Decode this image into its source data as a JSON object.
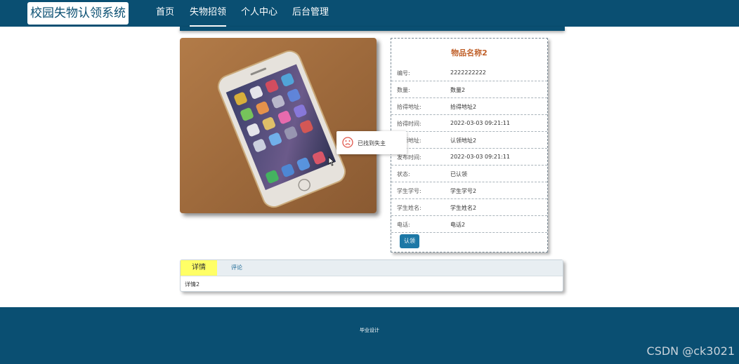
{
  "app": {
    "title": "校园失物认领系统"
  },
  "nav": [
    "首页",
    "失物招领",
    "个人中心",
    "后台管理"
  ],
  "item": {
    "name": "物品名称2",
    "fields": [
      {
        "label": "编号:",
        "value": "2222222222"
      },
      {
        "label": "数量:",
        "value": "数量2"
      },
      {
        "label": "拾得地址:",
        "value": "拾得地址2"
      },
      {
        "label": "拾得时间:",
        "value": "2022-03-03 09:21:11"
      },
      {
        "label": "认领地址:",
        "value": "认领地址2"
      },
      {
        "label": "发布时间:",
        "value": "2022-03-03 09:21:11"
      },
      {
        "label": "状态:",
        "value": "已认领"
      },
      {
        "label": "学生学号:",
        "value": "学生学号2"
      },
      {
        "label": "学生姓名:",
        "value": "学生姓名2"
      },
      {
        "label": "电话:",
        "value": "电话2"
      }
    ],
    "claim_label": "认领"
  },
  "toast": {
    "message": "已找到失主",
    "icon": "sad-face-icon"
  },
  "tabs": {
    "detail": "详情",
    "comment": "评论",
    "content": "详情2"
  },
  "footer": {
    "text": "毕业设计"
  },
  "watermark": "CSDN @ck3021",
  "colors": {
    "primary": "#0a4f72",
    "title": "#c0602a",
    "tab_active": "#ffff66",
    "button": "#1d78a6"
  }
}
